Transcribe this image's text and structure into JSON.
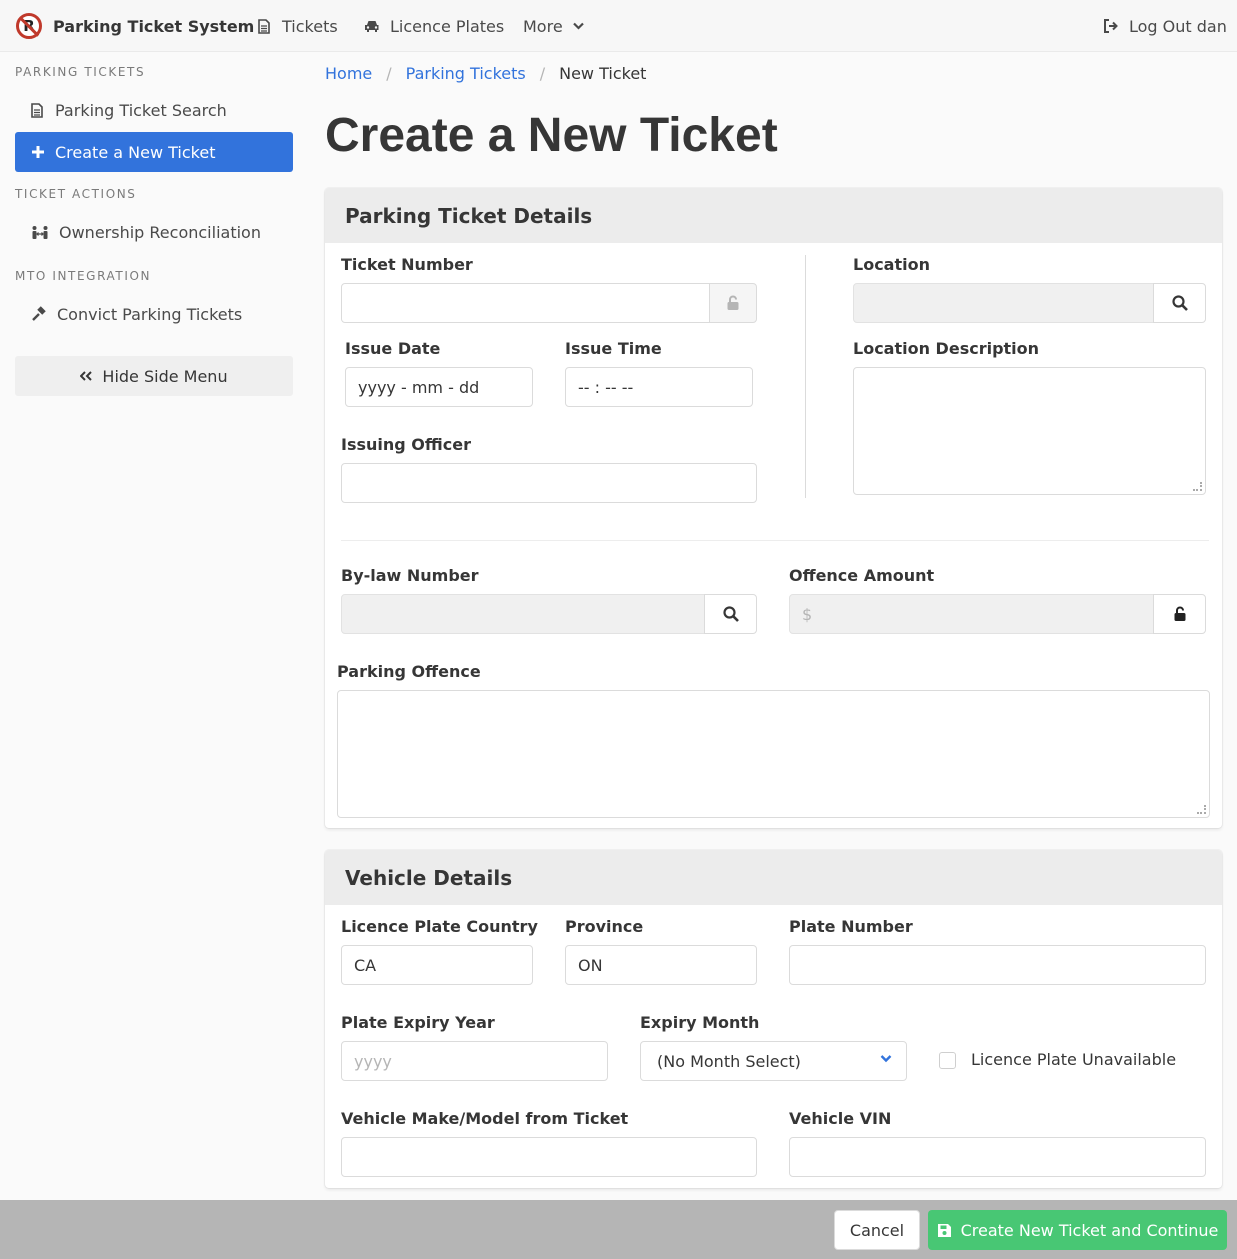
{
  "navbar": {
    "brand": "Parking Ticket System",
    "tickets": "Tickets",
    "licence_plates": "Licence Plates",
    "more": "More",
    "logout": "Log Out dan"
  },
  "sidebar": {
    "section1": "PARKING TICKETS",
    "search": "Parking Ticket Search",
    "create": "Create a New Ticket",
    "section2": "TICKET ACTIONS",
    "ownership": "Ownership Reconciliation",
    "section3": "MTO INTEGRATION",
    "convict": "Convict Parking Tickets",
    "hide": "Hide Side Menu"
  },
  "breadcrumb": {
    "home": "Home",
    "tickets": "Parking Tickets",
    "current": "New Ticket",
    "sep": "/"
  },
  "page_title": "Create a New Ticket",
  "ticket_details": {
    "heading": "Parking Ticket Details",
    "ticket_number_label": "Ticket Number",
    "ticket_number_value": "",
    "issue_date_label": "Issue Date",
    "issue_date_placeholder": "yyyy - mm - dd",
    "issue_time_label": "Issue Time",
    "issue_time_placeholder": "-- : --   --",
    "issuing_officer_label": "Issuing Officer",
    "location_label": "Location",
    "location_description_label": "Location Description",
    "bylaw_label": "By-law Number",
    "offence_amount_label": "Offence Amount",
    "offence_amount_prefix": "$",
    "parking_offence_label": "Parking Offence"
  },
  "vehicle_details": {
    "heading": "Vehicle Details",
    "country_label": "Licence Plate Country",
    "country_value": "CA",
    "province_label": "Province",
    "province_value": "ON",
    "plate_number_label": "Plate Number",
    "expiry_year_label": "Plate Expiry Year",
    "expiry_year_placeholder": "yyyy",
    "expiry_month_label": "Expiry Month",
    "expiry_month_value": "(No Month Select)",
    "plate_unavailable_label": "Licence Plate Unavailable",
    "make_model_label": "Vehicle Make/Model from Ticket",
    "vin_label": "Vehicle VIN"
  },
  "footer": {
    "cancel": "Cancel",
    "create": "Create New Ticket and Continue"
  },
  "colors": {
    "primary": "#3273dc",
    "success": "#48c774",
    "brand_red": "#c0392b"
  }
}
